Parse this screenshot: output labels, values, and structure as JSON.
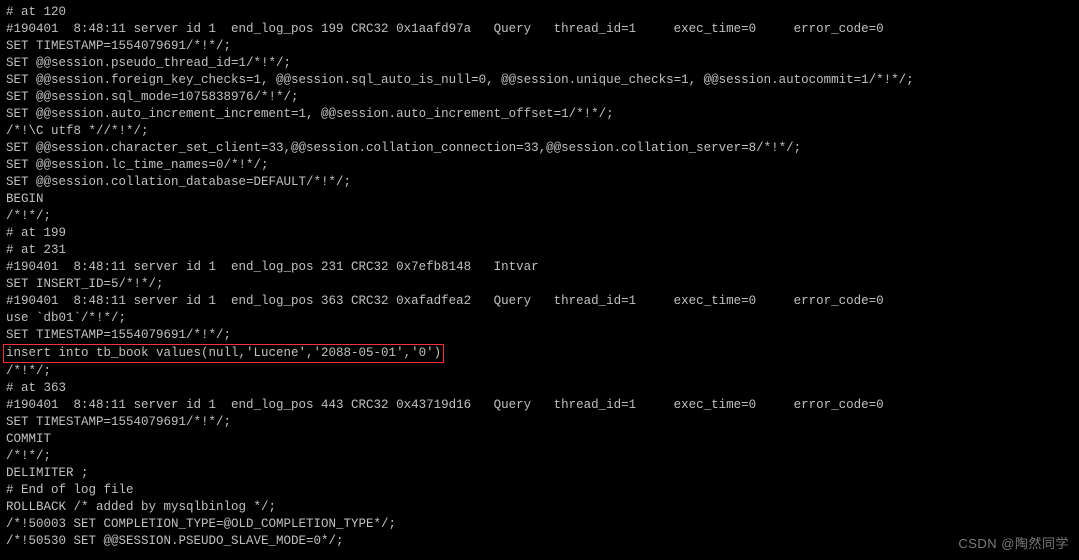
{
  "lines": [
    "# at 120",
    "#190401  8:48:11 server id 1  end_log_pos 199 CRC32 0x1aafd97a   Query   thread_id=1     exec_time=0     error_code=0",
    "SET TIMESTAMP=1554079691/*!*/;",
    "SET @@session.pseudo_thread_id=1/*!*/;",
    "SET @@session.foreign_key_checks=1, @@session.sql_auto_is_null=0, @@session.unique_checks=1, @@session.autocommit=1/*!*/;",
    "SET @@session.sql_mode=1075838976/*!*/;",
    "SET @@session.auto_increment_increment=1, @@session.auto_increment_offset=1/*!*/;",
    "/*!\\C utf8 *//*!*/;",
    "SET @@session.character_set_client=33,@@session.collation_connection=33,@@session.collation_server=8/*!*/;",
    "SET @@session.lc_time_names=0/*!*/;",
    "SET @@session.collation_database=DEFAULT/*!*/;",
    "BEGIN",
    "/*!*/;",
    "# at 199",
    "# at 231",
    "#190401  8:48:11 server id 1  end_log_pos 231 CRC32 0x7efb8148   Intvar",
    "SET INSERT_ID=5/*!*/;",
    "#190401  8:48:11 server id 1  end_log_pos 363 CRC32 0xafadfea2   Query   thread_id=1     exec_time=0     error_code=0",
    "use `db01`/*!*/;",
    "SET TIMESTAMP=1554079691/*!*/;"
  ],
  "highlighted_line": "insert into tb_book values(null,'Lucene','2088-05-01','0')",
  "lines_after": [
    "/*!*/;",
    "# at 363",
    "#190401  8:48:11 server id 1  end_log_pos 443 CRC32 0x43719d16   Query   thread_id=1     exec_time=0     error_code=0",
    "SET TIMESTAMP=1554079691/*!*/;",
    "COMMIT",
    "/*!*/;",
    "DELIMITER ;",
    "# End of log file",
    "ROLLBACK /* added by mysqlbinlog */;",
    "/*!50003 SET COMPLETION_TYPE=@OLD_COMPLETION_TYPE*/;",
    "/*!50530 SET @@SESSION.PSEUDO_SLAVE_MODE=0*/;"
  ],
  "watermark": "CSDN @陶然同学"
}
